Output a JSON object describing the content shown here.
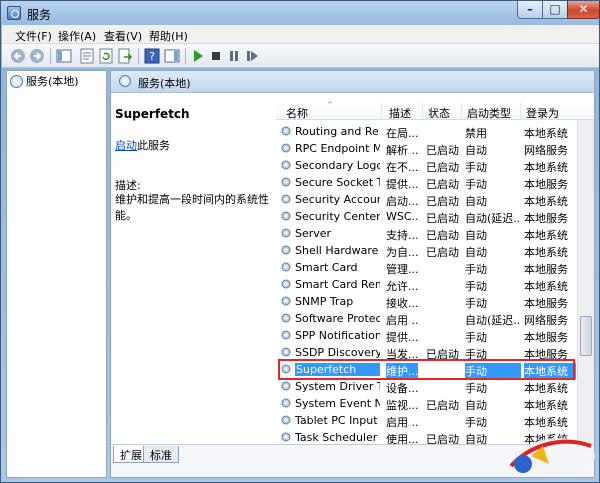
{
  "window": {
    "title": "服务"
  },
  "menu": [
    "文件(F)",
    "操作(A)",
    "查看(V)",
    "帮助(H)"
  ],
  "tree": {
    "root": "服务(本地)"
  },
  "main": {
    "header": "服务(本地)"
  },
  "detail": {
    "service_name": "Superfetch",
    "action_link": "启动",
    "action_suffix": "此服务",
    "desc_label": "描述:",
    "desc_text": "维护和提高一段时间内的系统性能。"
  },
  "columns": [
    "名称",
    "描述",
    "状态",
    "启动类型",
    "登录为"
  ],
  "services": [
    {
      "name": "Routing and Re...",
      "desc": "在局...",
      "status": "",
      "startup": "禁用",
      "logon": "本地系统"
    },
    {
      "name": "RPC Endpoint M...",
      "desc": "解析 ...",
      "status": "已启动",
      "startup": "自动",
      "logon": "网络服务"
    },
    {
      "name": "Secondary Logon",
      "desc": "在不...",
      "status": "已启动",
      "startup": "手动",
      "logon": "本地系统"
    },
    {
      "name": "Secure Socket T...",
      "desc": "提供...",
      "status": "已启动",
      "startup": "手动",
      "logon": "本地服务"
    },
    {
      "name": "Security Account...",
      "desc": "启动...",
      "status": "已启动",
      "startup": "自动",
      "logon": "本地系统"
    },
    {
      "name": "Security Center",
      "desc": "WSC...",
      "status": "已启动",
      "startup": "自动(延迟...",
      "logon": "本地服务"
    },
    {
      "name": "Server",
      "desc": "支持...",
      "status": "已启动",
      "startup": "自动",
      "logon": "本地系统"
    },
    {
      "name": "Shell Hardware ...",
      "desc": "为自...",
      "status": "已启动",
      "startup": "自动",
      "logon": "本地系统"
    },
    {
      "name": "Smart Card",
      "desc": "管理...",
      "status": "",
      "startup": "手动",
      "logon": "本地服务"
    },
    {
      "name": "Smart Card Rem...",
      "desc": "允许...",
      "status": "",
      "startup": "手动",
      "logon": "本地系统"
    },
    {
      "name": "SNMP Trap",
      "desc": "接收...",
      "status": "",
      "startup": "手动",
      "logon": "本地服务"
    },
    {
      "name": "Software Protect...",
      "desc": "启用 ...",
      "status": "",
      "startup": "自动(延迟...",
      "logon": "网络服务"
    },
    {
      "name": "SPP Notification ...",
      "desc": "提供...",
      "status": "",
      "startup": "手动",
      "logon": "本地服务"
    },
    {
      "name": "SSDP Discovery",
      "desc": "当发...",
      "status": "已启动",
      "startup": "手动",
      "logon": "本地服务"
    },
    {
      "name": "Superfetch",
      "desc": "维护...",
      "status": "",
      "startup": "手动",
      "logon": "本地系统"
    },
    {
      "name": "System Driver T...",
      "desc": "设备...",
      "status": "",
      "startup": "手动",
      "logon": "本地系统"
    },
    {
      "name": "System Event N...",
      "desc": "监视...",
      "status": "已启动",
      "startup": "自动",
      "logon": "本地系统"
    },
    {
      "name": "Tablet PC Input ...",
      "desc": "启用 ...",
      "status": "",
      "startup": "手动",
      "logon": "本地系统"
    },
    {
      "name": "Task Scheduler",
      "desc": "使用...",
      "status": "已启动",
      "startup": "自动",
      "logon": "本地系统"
    }
  ],
  "selected_index": 14,
  "tabs": [
    "扩展",
    "标准"
  ],
  "colors": {
    "selection": "#3399ff",
    "highlight_border": "#e0282b",
    "link": "#0645c8"
  }
}
